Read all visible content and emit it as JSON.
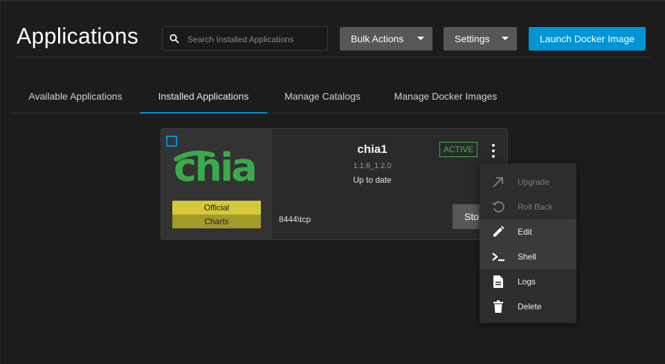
{
  "page": {
    "title": "Applications",
    "search_placeholder": "Search Installed Applications"
  },
  "toolbar": {
    "bulk_actions_label": "Bulk Actions",
    "settings_label": "Settings",
    "launch_label": "Launch Docker Image"
  },
  "tabs": [
    {
      "label": "Available Applications",
      "active": false
    },
    {
      "label": "Installed Applications",
      "active": true
    },
    {
      "label": "Manage Catalogs",
      "active": false
    },
    {
      "label": "Manage Docker Images",
      "active": false
    }
  ],
  "app_card": {
    "logo_text": "chia",
    "badge_line1": "Official",
    "badge_line2": "Charts",
    "name": "chia1",
    "version": "1.1.6_1.2.0",
    "update_status": "Up to date",
    "status": "ACTIVE",
    "ports": "8444\\tcp",
    "stop_label": "Stop"
  },
  "context_menu": {
    "items": [
      {
        "label": "Upgrade",
        "icon": "upgrade-icon",
        "enabled": false
      },
      {
        "label": "Roll Back",
        "icon": "rollback-icon",
        "enabled": false
      },
      {
        "label": "Edit",
        "icon": "edit-icon",
        "enabled": true
      },
      {
        "label": "Shell",
        "icon": "shell-icon",
        "enabled": true
      },
      {
        "label": "Logs",
        "icon": "logs-icon",
        "enabled": true
      },
      {
        "label": "Delete",
        "icon": "delete-icon",
        "enabled": true
      }
    ]
  },
  "colors": {
    "accent": "#0095d5",
    "active_status": "#4caf50",
    "logo_green": "#3aaa4a",
    "badge_yellow": "#d6c93a"
  }
}
